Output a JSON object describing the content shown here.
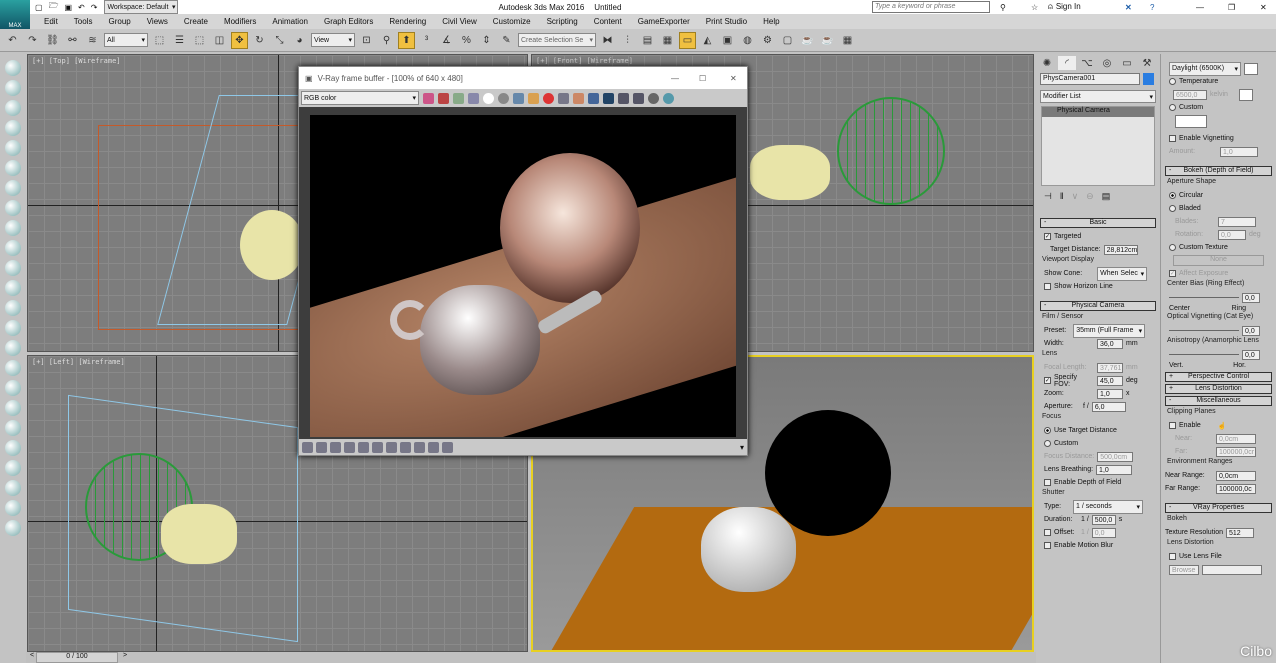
{
  "app": {
    "logo": "MAX",
    "title": "Autodesk 3ds Max 2016",
    "doc": "Untitled",
    "workspace": "Workspace: Default",
    "search_placeholder": "Type a keyword or phrase",
    "sign_in": "Sign In"
  },
  "menu": [
    "Edit",
    "Tools",
    "Group",
    "Views",
    "Create",
    "Modifiers",
    "Animation",
    "Graph Editors",
    "Rendering",
    "Civil View",
    "Customize",
    "Scripting",
    "Content",
    "GameExporter",
    "Print Studio",
    "Help"
  ],
  "toolbar": {
    "filter": "All",
    "ref_coord": "View",
    "selection_set_placeholder": "Create Selection Se"
  },
  "viewports": {
    "top": "[+] [Top] [Wireframe]",
    "front": "[+] [Front] [Wireframe]",
    "left": "[+] [Left] [Wireframe]"
  },
  "vfb": {
    "title": "V-Ray frame buffer - [100% of 640 x 480]",
    "channel": "RGB color"
  },
  "timeline": {
    "frame": "0 / 100",
    "prev": "<",
    "next": ">"
  },
  "command_panel": {
    "object_name": "PhysCamera001",
    "object_color": "#2a7de1",
    "modifier_list": "Modifier List",
    "stack_item": "Physical Camera",
    "basic": {
      "title": "Basic",
      "targeted": "Targeted",
      "target_distance_label": "Target Distance:",
      "target_distance": "28,812cm",
      "viewport_display": "Viewport Display",
      "show_cone_label": "Show Cone:",
      "show_cone": "When Selec",
      "show_horizon": "Show Horizon Line"
    },
    "physical": {
      "title": "Physical Camera",
      "film": "Film / Sensor",
      "preset_label": "Preset:",
      "preset": "35mm (Full Frame",
      "width_label": "Width:",
      "width": "36,0",
      "mm": "mm",
      "lens": "Lens",
      "focal_label": "Focal Length:",
      "focal": "37,761",
      "specify_fov": "Specify FOV:",
      "fov": "45,0",
      "deg": "deg",
      "zoom_label": "Zoom:",
      "zoom": "1,0",
      "x": "x",
      "aperture_label": "Aperture:",
      "f": "f /",
      "aperture": "6,0",
      "focus": "Focus",
      "use_target": "Use Target Distance",
      "custom": "Custom",
      "focus_dist_label": "Focus Distance:",
      "focus_dist": "500,0cm",
      "breathing_label": "Lens Breathing:",
      "breathing": "1,0",
      "enable_dof": "Enable Depth of Field",
      "shutter": "Shutter",
      "type_label": "Type:",
      "type": "1 / seconds",
      "duration_label": "Duration:",
      "one_over": "1 /",
      "duration": "500,0",
      "s": "s",
      "offset": "Offset:",
      "offset_val": "0,0",
      "motion_blur": "Enable Motion Blur"
    },
    "col2": {
      "wb": "Daylight (6500K)",
      "temperature": "Temperature",
      "temp_val": "6500,0",
      "kelvin": "kelvin",
      "custom": "Custom",
      "vignetting": "Enable Vignetting",
      "amount_label": "Amount:",
      "amount": "1,0",
      "bokeh_title": "Bokeh (Depth of Field)",
      "aperture_shape": "Aperture Shape",
      "circular": "Circular",
      "bladed": "Bladed",
      "blades_label": "Blades:",
      "blades": "7",
      "rotation_label": "Rotation:",
      "rotation": "0,0",
      "custom_texture": "Custom Texture",
      "none": "None",
      "affect_exposure": "Affect Exposure",
      "center_bias": "Center Bias (Ring Effect)",
      "center": "Center",
      "ring": "Ring",
      "center_bias_val": "0,0",
      "optical_vig": "Optical Vignetting (Cat Eye)",
      "optical_val": "0,0",
      "anisotropy": "Anisotropy (Anamorphic Lens",
      "vert": "Vert.",
      "hor": "Hor.",
      "aniso_val": "0,0",
      "perspective": "Perspective Control",
      "lens_distortion": "Lens Distortion",
      "misc": "Miscellaneous",
      "clipping": "Clipping Planes",
      "enable": "Enable",
      "near_label": "Near:",
      "near": "0,0cm",
      "far_label": "Far:",
      "far": "100000,0cr",
      "env_ranges": "Environment Ranges",
      "near_range_label": "Near Range:",
      "near_range": "0,0cm",
      "far_range_label": "Far Range:",
      "far_range": "100000,0c",
      "vray": "VRay Properties",
      "bokeh": "Bokeh",
      "tex_res_label": "Texture Resolution",
      "tex_res": "512",
      "lens_dist": "Lens Distortion",
      "use_lens_file": "Use Lens File",
      "browse": "Browse"
    }
  },
  "watermark": "Cilbo"
}
